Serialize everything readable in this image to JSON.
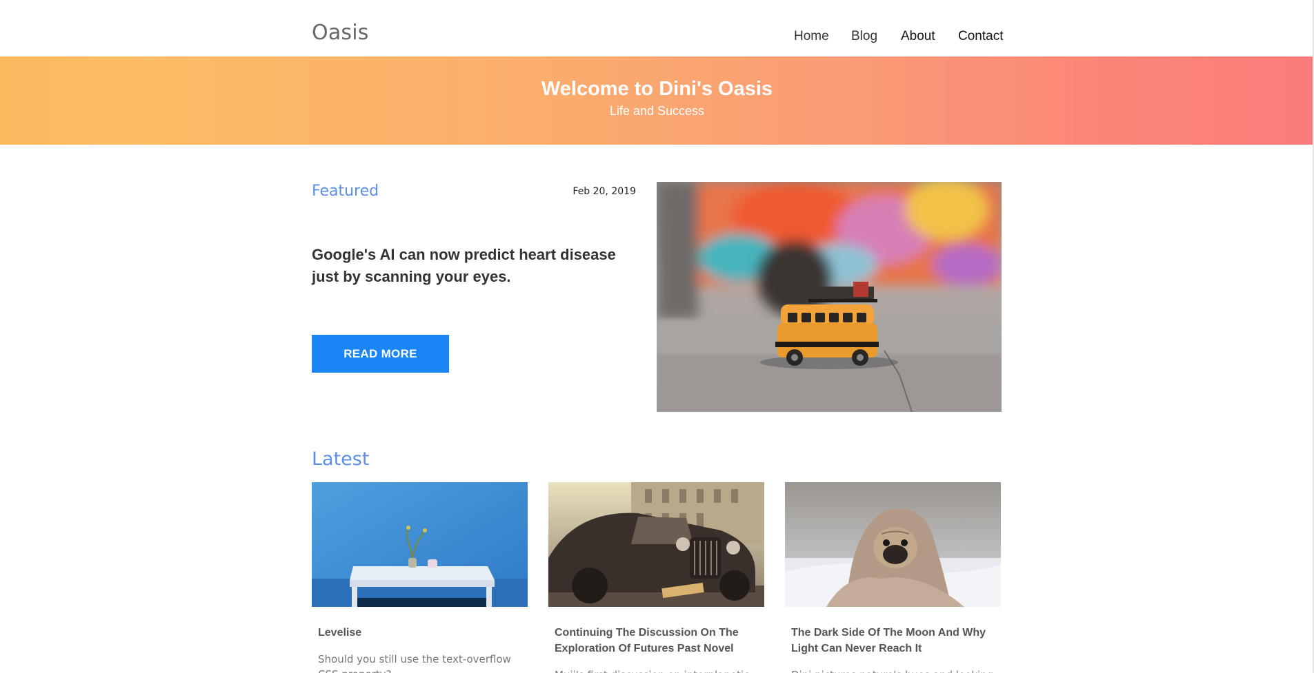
{
  "header": {
    "logo": "Oasis",
    "nav": [
      {
        "label": "Home"
      },
      {
        "label": "Blog"
      },
      {
        "label": "About"
      },
      {
        "label": "Contact"
      }
    ]
  },
  "hero": {
    "title": "Welcome to Dini's Oasis",
    "subtitle": "Life and Success",
    "gradient": [
      "#fcb95e",
      "#fb7c7b"
    ]
  },
  "featured": {
    "label": "Featured",
    "date": "Feb 20, 2019",
    "headline": "Google's AI can now predict heart disease just by scanning your eyes.",
    "button_label": "READ MORE",
    "image_name": "toy-bus-photo"
  },
  "latest": {
    "label": "Latest",
    "cards": [
      {
        "title": "Levelise",
        "excerpt": "Should you still use the text-overflow CSS property?",
        "image_name": "blue-wall-table-photo"
      },
      {
        "title": "Continuing The Discussion On The Exploration Of Futures Past Novel",
        "excerpt": "Muji's first discussion on interplanetic",
        "image_name": "vintage-car-photo"
      },
      {
        "title": "The Dark Side Of The Moon And Why Light Can Never Reach It",
        "excerpt": "Dini pictures nature's hues and looking the",
        "image_name": "pug-blanket-photo"
      }
    ]
  },
  "colors": {
    "accent_blue": "#5b8ee6",
    "button_blue": "#1a86f5"
  }
}
